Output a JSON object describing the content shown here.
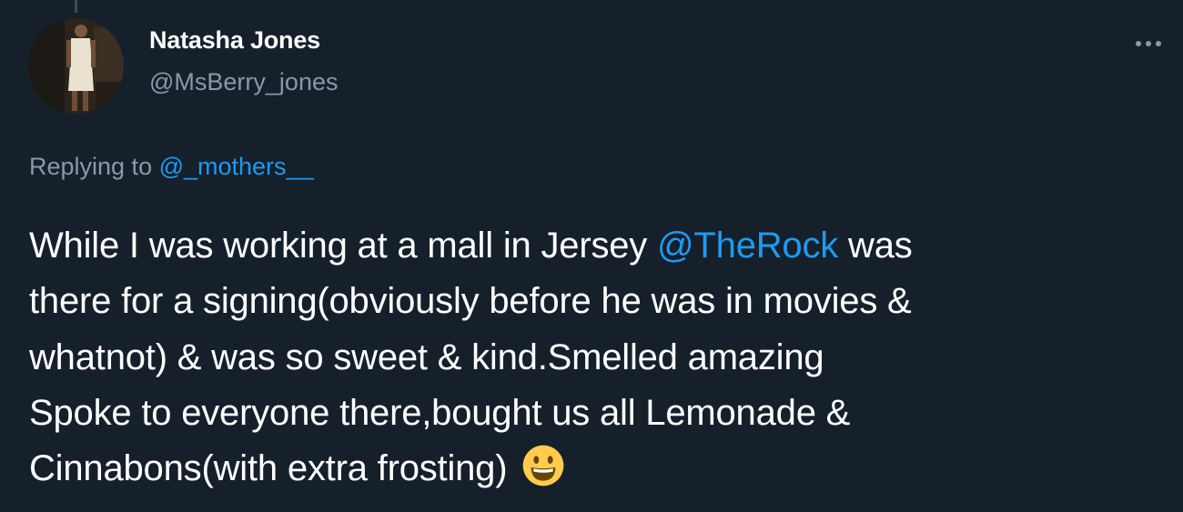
{
  "tweet": {
    "author": {
      "display_name": "Natasha Jones",
      "handle": "@MsBerry_jones"
    },
    "more_icon": "more-horizontal-icon",
    "replying": {
      "prefix": "Replying to ",
      "mention": "@_mothers__"
    },
    "body": {
      "line1_before": "While I was working at a mall in Jersey ",
      "line1_mention": "@TheRock",
      "line1_after": " was",
      "line2": "there for a signing(obviously before he was in movies &",
      "line3": "whatnot) & was so sweet & kind.Smelled amazing",
      "line4": "Spoke to everyone there,bought us all Lemonade &",
      "line5": "Cinnabons(with extra frosting) ",
      "emoji": "grinning-face-emoji"
    },
    "colors": {
      "background": "#15202b",
      "link": "#1d9bf0",
      "secondary_text": "#8b98a5"
    }
  }
}
